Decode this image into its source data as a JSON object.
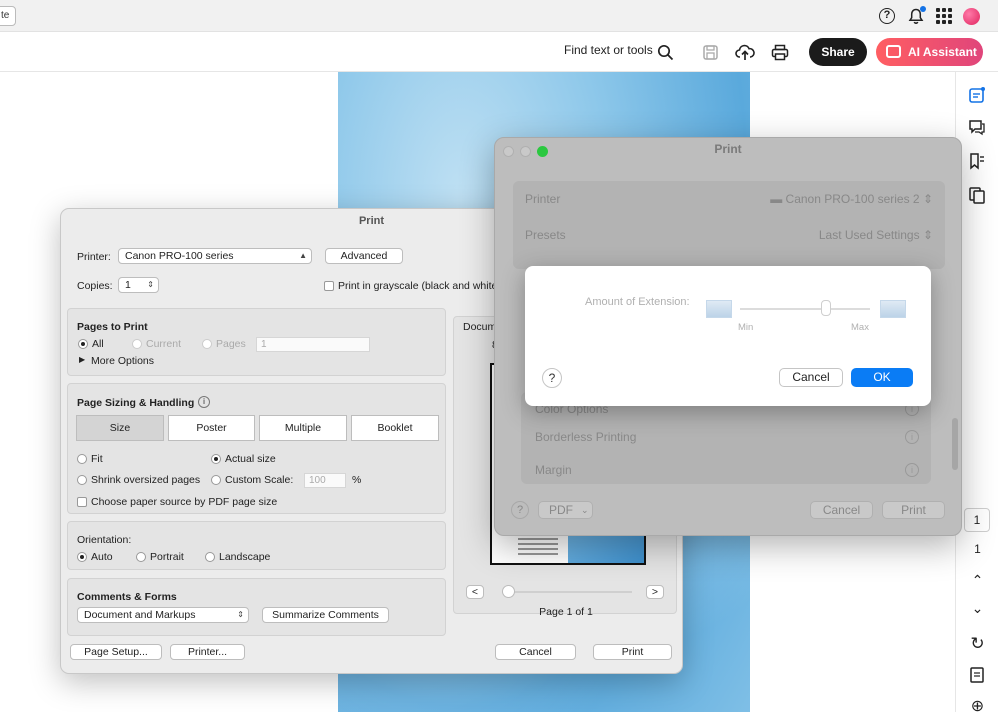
{
  "topbar": {
    "tab_stub": "te",
    "help_glyph": "?",
    "icons": [
      "help-icon",
      "bell-icon",
      "apps-grid-icon",
      "avatar"
    ]
  },
  "toolbar": {
    "find_label": "Find text or tools",
    "share_label": "Share",
    "ai_label": "AI Assistant",
    "icons": [
      "search-icon",
      "save-icon",
      "upload-cloud-icon",
      "printer-icon"
    ]
  },
  "rail": {
    "page_box": "1",
    "page_num": "1",
    "up_glyph": "⌃",
    "down_glyph": "⌄",
    "refresh_glyph": "↻",
    "zoom_glyph": "⊕"
  },
  "adobe_print": {
    "title": "Print",
    "printer_label": "Printer:",
    "printer_value": "Canon PRO-100 series",
    "advanced_label": "Advanced",
    "copies_label": "Copies:",
    "copies_value": "1",
    "grayscale_label": "Print in grayscale (black and white)",
    "pages_title": "Pages to Print",
    "all_label": "All",
    "current_label": "Current",
    "pages_label": "Pages",
    "pages_value": "1",
    "more_options_label": "More Options",
    "sizing_title": "Page Sizing & Handling",
    "info_glyph": "i",
    "sizing_tabs": [
      "Size",
      "Poster",
      "Multiple",
      "Booklet"
    ],
    "fit_label": "Fit",
    "actual_size_label": "Actual size",
    "shrink_label": "Shrink oversized pages",
    "custom_scale_label": "Custom Scale:",
    "custom_scale_value": "100",
    "percent_label": "%",
    "paper_source_label": "Choose paper source by PDF page size",
    "orientation_title": "Orientation:",
    "auto_label": "Auto",
    "portrait_label": "Portrait",
    "landscape_label": "Landscape",
    "comments_title": "Comments & Forms",
    "comments_value": "Document and Markups",
    "summarize_label": "Summarize Comments",
    "preview_label": "Docum",
    "preview_size": "8",
    "prev_label": "<",
    "next_label": ">",
    "page_of": "Page 1 of 1",
    "page_setup_label": "Page Setup...",
    "printer_btn_label": "Printer...",
    "cancel_label": "Cancel",
    "print_label": "Print"
  },
  "mac_print": {
    "title": "Print",
    "printer_key": "Printer",
    "printer_value": "Canon PRO-100 series 2",
    "presets_key": "Presets",
    "presets_value": "Last Used Settings",
    "list_items": [
      "Color Options",
      "Borderless Printing",
      "Margin"
    ],
    "help_glyph": "?",
    "info_glyph": "i",
    "pdf_label": "PDF",
    "cancel_label": "Cancel",
    "print_label": "Print"
  },
  "extension_sheet": {
    "label": "Amount of Extension:",
    "min_label": "Min",
    "max_label": "Max",
    "help_glyph": "?",
    "cancel_label": "Cancel",
    "ok_label": "OK",
    "accent": "#0a7cf5"
  }
}
